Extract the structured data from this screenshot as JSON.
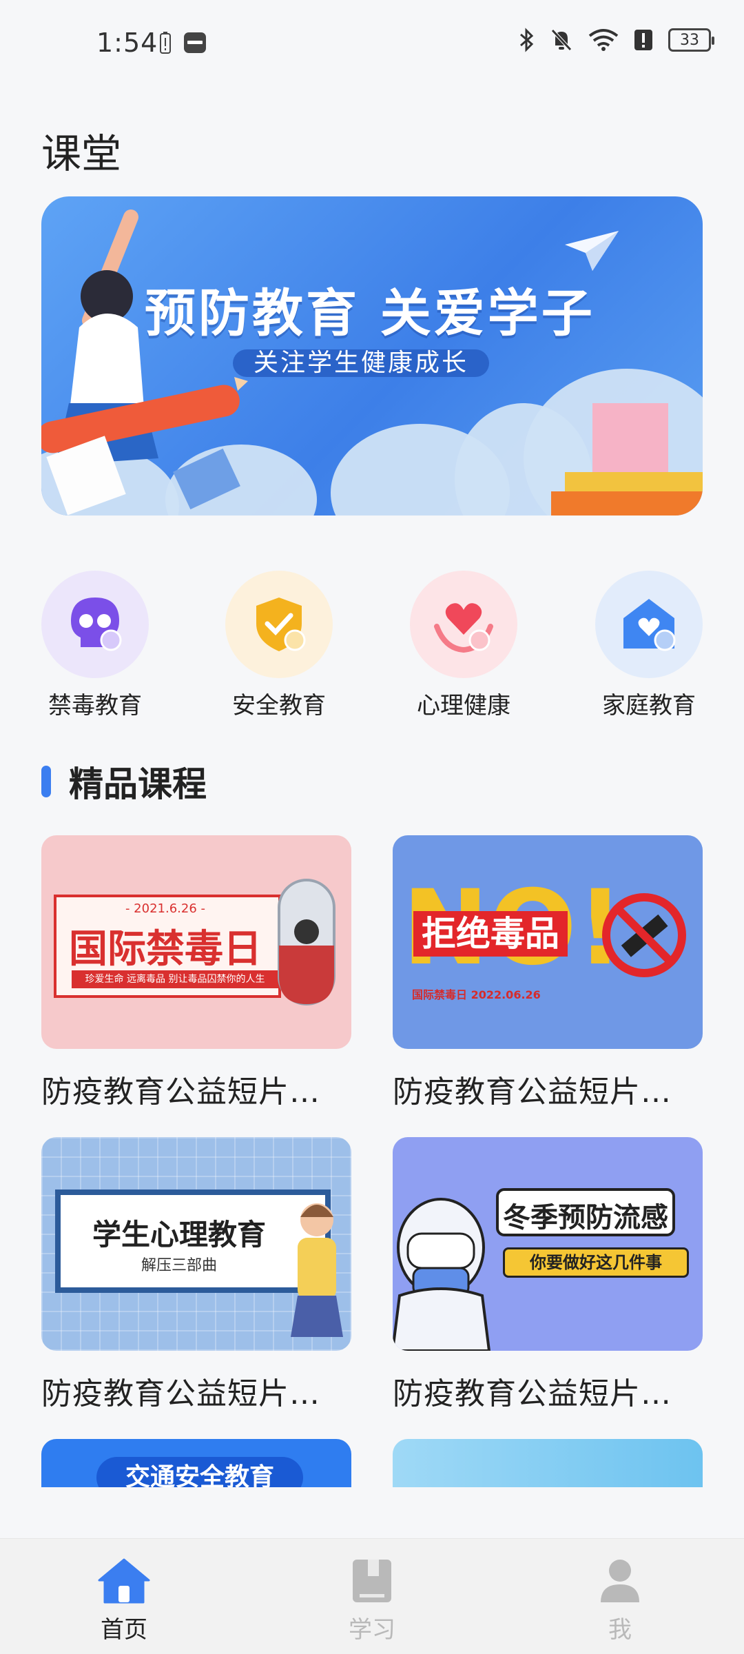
{
  "status_bar": {
    "time": "1:54",
    "battery": "33",
    "left_icons": [
      "battery-alert-icon",
      "huawei-app-icon"
    ],
    "right_icons": [
      "bluetooth-icon",
      "bell-off-icon",
      "wifi-icon",
      "alert-icon"
    ]
  },
  "page": {
    "title": "课堂"
  },
  "banner": {
    "headline": "预防教育 关爱学子",
    "subtitle": "关注学生健康成长"
  },
  "categories": [
    {
      "label": "禁毒教育",
      "icon": "skull-icon",
      "color": "#7b4fe8",
      "bg": "#ece6fb"
    },
    {
      "label": "安全教育",
      "icon": "shield-check-icon",
      "color": "#f4b21e",
      "bg": "#fdf1dc"
    },
    {
      "label": "心理健康",
      "icon": "heart-hands-icon",
      "color": "#f0485a",
      "bg": "#fde4e7"
    },
    {
      "label": "家庭教育",
      "icon": "home-heart-icon",
      "color": "#3f86f2",
      "bg": "#e2ecfb"
    }
  ],
  "section": {
    "title": "精品课程"
  },
  "courses": [
    {
      "title": "防疫教育公益短片…",
      "thumb_text": "国际禁毒日",
      "thumb_date": "- 2021.6.26 -",
      "thumb_sub": "珍爱生命 远离毒品 别让毒品囚禁你的人生"
    },
    {
      "title": "防疫教育公益短片…",
      "thumb_text": "拒绝毒品",
      "thumb_big": "NO!",
      "thumb_sub": "国际禁毒日 2022.06.26"
    },
    {
      "title": "防疫教育公益短片…",
      "thumb_text": "学生心理教育",
      "thumb_sub": "解压三部曲"
    },
    {
      "title": "防疫教育公益短片…",
      "thumb_text": "冬季预防流感",
      "thumb_sub": "你要做好这几件事"
    },
    {
      "title": "",
      "thumb_text": "交通安全教育"
    },
    {
      "title": "",
      "thumb_text": ""
    }
  ],
  "bottom_nav": [
    {
      "label": "首页",
      "icon": "home-icon",
      "active": true
    },
    {
      "label": "学习",
      "icon": "book-icon",
      "active": false
    },
    {
      "label": "我",
      "icon": "person-icon",
      "active": false
    }
  ],
  "colors": {
    "accent": "#3b7ef0",
    "inactive": "#b9b9b9"
  }
}
